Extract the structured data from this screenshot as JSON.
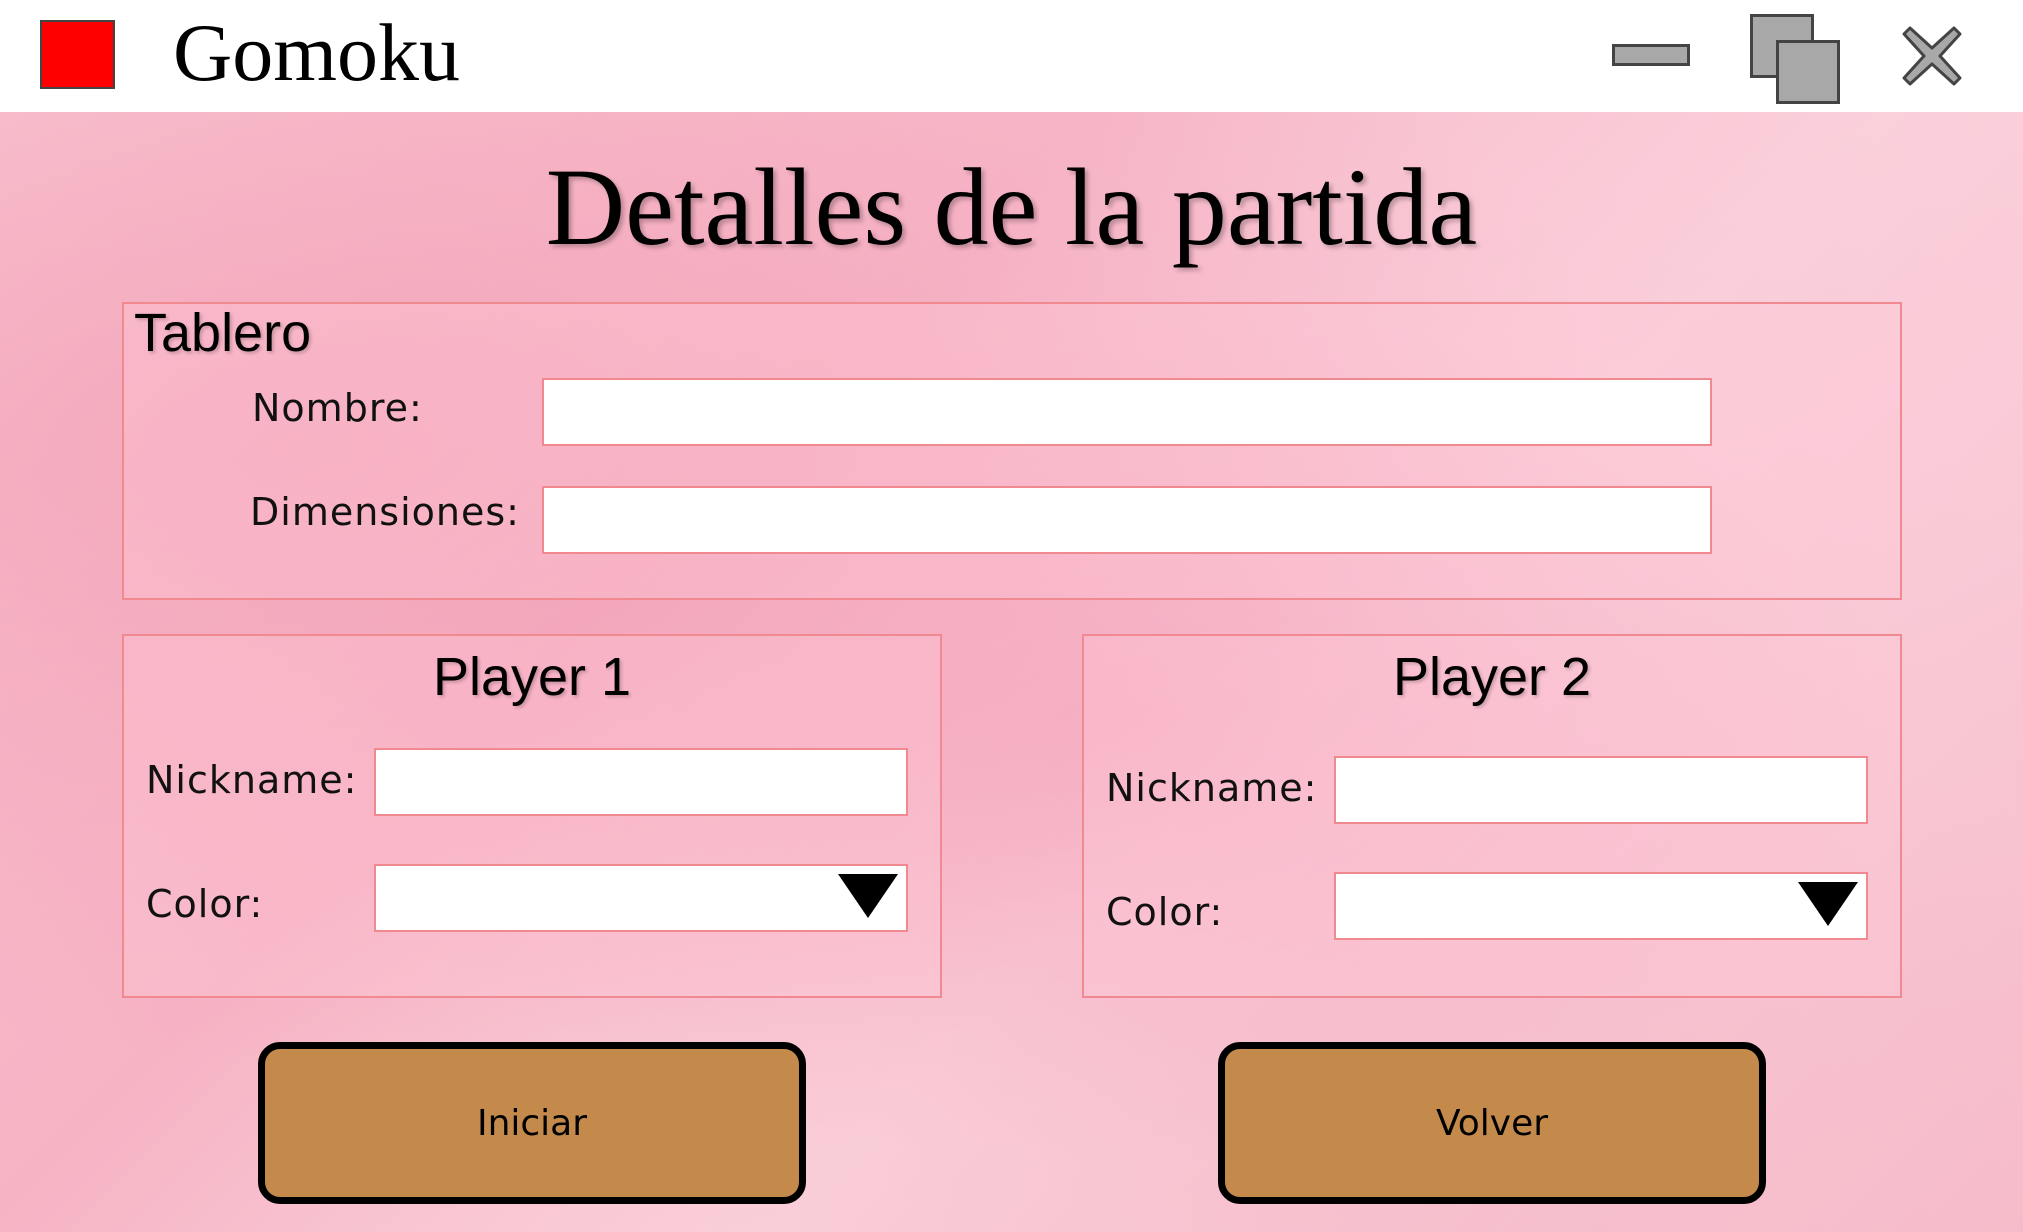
{
  "window": {
    "title": "Gomoku",
    "controls": [
      "minimize-icon",
      "maximize-icon",
      "close-icon"
    ]
  },
  "page": {
    "heading": "Detalles de la partida"
  },
  "board": {
    "title": "Tablero",
    "name_label": "Nombre:",
    "name_value": "",
    "dimensions_label": "Dimensiones:",
    "dimensions_value": ""
  },
  "player1": {
    "title": "Player 1",
    "nickname_label": "Nickname:",
    "nickname_value": "",
    "color_label": "Color:",
    "color_value": ""
  },
  "player2": {
    "title": "Player 2",
    "nickname_label": "Nickname:",
    "nickname_value": "",
    "color_label": "Color:",
    "color_value": ""
  },
  "actions": {
    "start_label": "Iniciar",
    "back_label": "Volver"
  },
  "colors": {
    "accent_border": "#f08a90",
    "button_fill": "#c48a4c",
    "app_icon": "#ff0000"
  }
}
